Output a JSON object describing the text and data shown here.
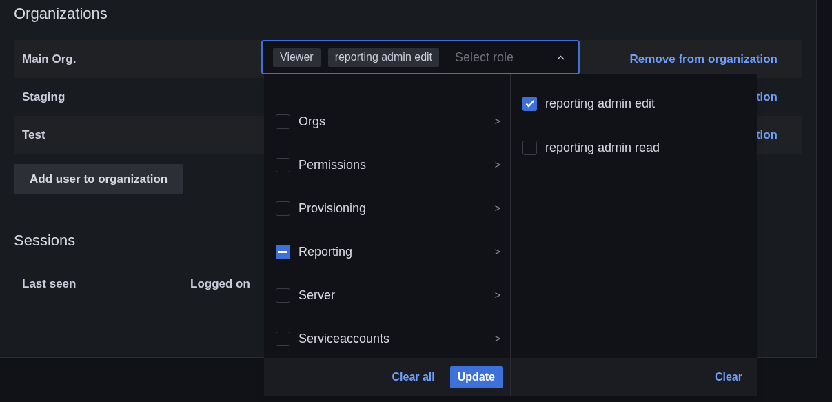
{
  "organizations": {
    "title": "Organizations",
    "rows": [
      {
        "name": "Main Org.",
        "action": "Remove from organization"
      },
      {
        "name": "Staging",
        "action": "tion"
      },
      {
        "name": "Test",
        "action": "tion"
      }
    ],
    "add_button": "Add user to organization"
  },
  "role_picker": {
    "tags": [
      "Viewer",
      "reporting admin edit"
    ],
    "placeholder": "Select role",
    "expanded": true,
    "categories": [
      {
        "label": "Orgs",
        "partial": false,
        "arrow": ">"
      },
      {
        "label": "Permissions",
        "partial": false,
        "arrow": ">"
      },
      {
        "label": "Provisioning",
        "partial": false,
        "arrow": ">"
      },
      {
        "label": "Reporting",
        "partial": true,
        "arrow": ">"
      },
      {
        "label": "Server",
        "partial": false,
        "arrow": ">"
      },
      {
        "label": "Serviceaccounts",
        "partial": false,
        "arrow": ">"
      }
    ],
    "roles": [
      {
        "label": "reporting admin edit",
        "checked": true
      },
      {
        "label": "reporting admin read",
        "checked": false
      }
    ],
    "clear_all": "Clear all",
    "update": "Update",
    "clear": "Clear"
  },
  "sessions": {
    "title": "Sessions",
    "columns": [
      "Last seen",
      "Logged on"
    ]
  }
}
